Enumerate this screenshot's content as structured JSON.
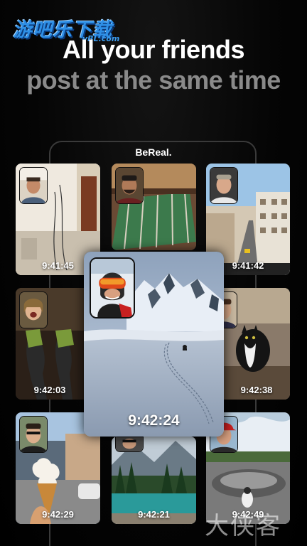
{
  "watermark": {
    "chinese": "游吧乐下载",
    "url": "yBL.com",
    "bottom": "大侠客"
  },
  "headline": {
    "line1": "All your friends",
    "line2": "post at the same time"
  },
  "app": {
    "brand": "BeReal."
  },
  "posts": [
    {
      "time": "9:41:45"
    },
    {
      "time": "9:41:42"
    },
    {
      "time": "9:42:03"
    },
    {
      "time": "9:42:38"
    },
    {
      "time": "9:42:29"
    },
    {
      "time": "9:42:21"
    },
    {
      "time": "9:42:49"
    },
    {
      "time": "9:42:24"
    }
  ]
}
